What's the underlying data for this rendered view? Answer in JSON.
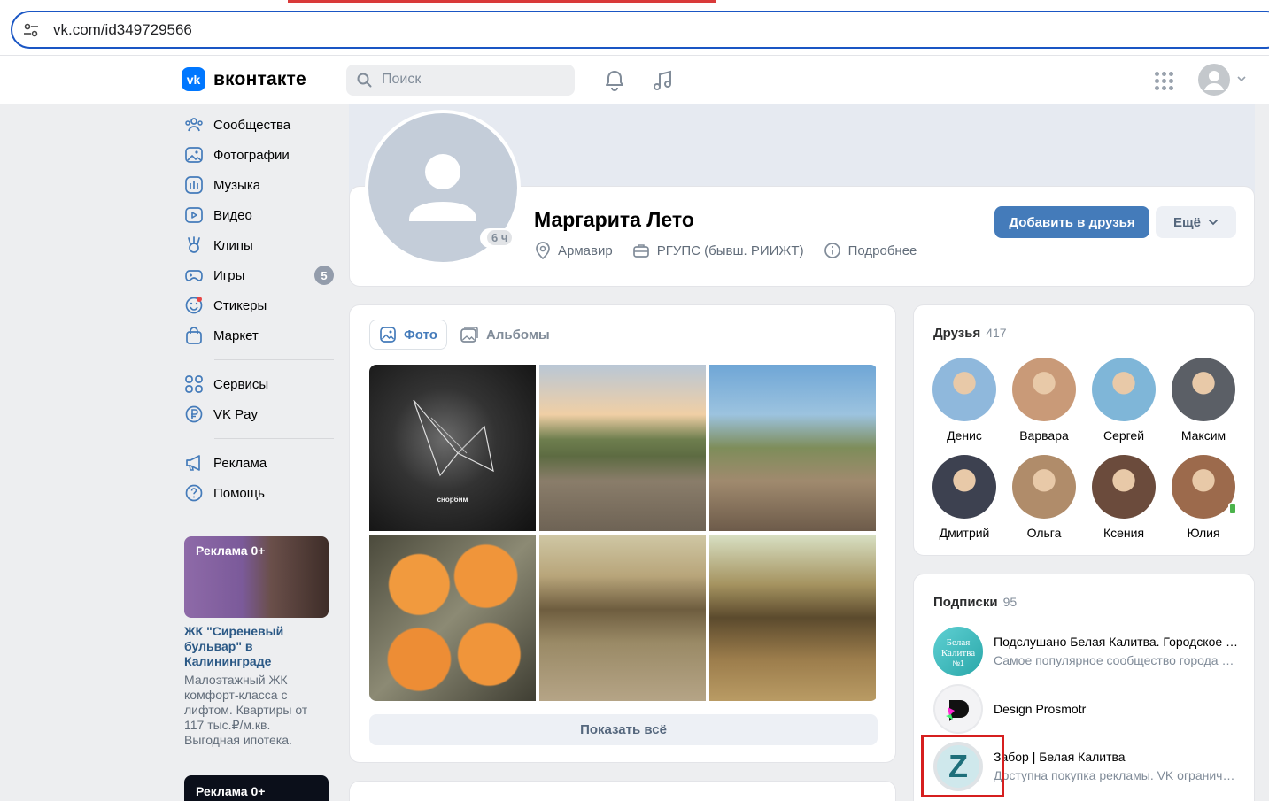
{
  "browser": {
    "url": "vk.com/id349729566"
  },
  "header": {
    "logo_text": "вконтакте",
    "search_placeholder": "Поиск"
  },
  "nav": {
    "items": [
      {
        "label": "Сообщества",
        "icon": "communities-icon"
      },
      {
        "label": "Фотографии",
        "icon": "photos-icon"
      },
      {
        "label": "Музыка",
        "icon": "music-icon"
      },
      {
        "label": "Видео",
        "icon": "video-icon"
      },
      {
        "label": "Клипы",
        "icon": "clips-icon"
      },
      {
        "label": "Игры",
        "icon": "games-icon",
        "badge": "5"
      },
      {
        "label": "Стикеры",
        "icon": "stickers-icon"
      },
      {
        "label": "Маркет",
        "icon": "market-icon"
      }
    ],
    "items2": [
      {
        "label": "Сервисы",
        "icon": "services-icon"
      },
      {
        "label": "VK Pay",
        "icon": "vkpay-icon"
      }
    ],
    "items3": [
      {
        "label": "Реклама",
        "icon": "ads-icon"
      },
      {
        "label": "Помощь",
        "icon": "help-icon"
      }
    ]
  },
  "ad": {
    "label": "Реклама 0+",
    "title": "ЖК \"Сиреневый бульвар\" в Калининграде",
    "description": "Малоэтажный ЖК комфорт-класса с лифтом. Квартиры от 117 тыс.₽/м.кв. Выгодная ипотека.",
    "label2": "Реклама 0+"
  },
  "profile": {
    "name": "Маргарита Лето",
    "online_badge": "6 ч",
    "city": "Армавир",
    "education": "РГУПС (бывш. РИИЖТ)",
    "more_info": "Подробнее",
    "add_friend": "Добавить в друзья",
    "more": "Ещё"
  },
  "photos": {
    "tab_photo": "Фото",
    "tab_albums": "Альбомы",
    "caption1": "снорбим",
    "show_all": "Показать всё"
  },
  "friends": {
    "title": "Друзья",
    "count": "417",
    "list": [
      {
        "name": "Денис",
        "color": "#8fb8dc"
      },
      {
        "name": "Варвара",
        "color": "#c99a78"
      },
      {
        "name": "Сергей",
        "color": "#7fb6d8"
      },
      {
        "name": "Максим",
        "color": "#5b5f66"
      },
      {
        "name": "Дмитрий",
        "color": "#3d4150"
      },
      {
        "name": "Ольга",
        "color": "#b08c6a"
      },
      {
        "name": "Ксения",
        "color": "#6b4b3c"
      },
      {
        "name": "Юлия",
        "color": "#9c6a4c"
      }
    ]
  },
  "subscriptions": {
    "title": "Подписки",
    "count": "95",
    "list": [
      {
        "title": "Подслушано Белая Калитва. Городское сообщество",
        "desc": "Самое популярное сообщество города Белая Калитва",
        "avatar_text": "Белая Калитва",
        "avatar_sub": "№1"
      },
      {
        "title": "Design Prosmotr",
        "desc": ""
      },
      {
        "title": "Забор | Белая Калитва",
        "desc": "Доступна покупка рекламы. VK ограничивает",
        "avatar_text": "Z"
      }
    ]
  }
}
